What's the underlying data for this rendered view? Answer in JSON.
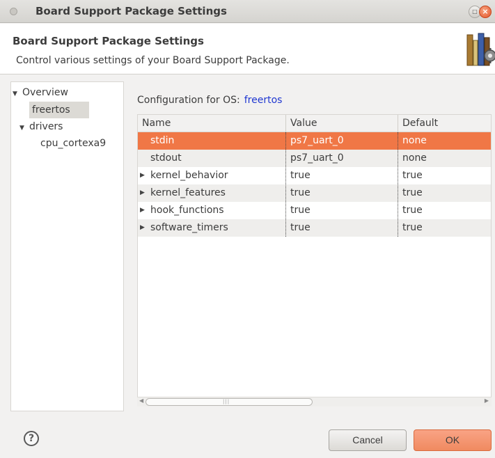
{
  "window": {
    "title": "Board Support Package Settings"
  },
  "header": {
    "title": "Board Support Package Settings",
    "description": "Control various settings of your Board Support Package."
  },
  "nav": {
    "items": [
      {
        "label": "Overview",
        "expanded": true
      },
      {
        "label": "freertos",
        "selected": true
      },
      {
        "label": "drivers",
        "expanded": true
      },
      {
        "label": "cpu_cortexa9"
      }
    ]
  },
  "config": {
    "label": "Configuration for OS:",
    "os": "freertos"
  },
  "table": {
    "columns": [
      "Name",
      "Value",
      "Default"
    ],
    "rows": [
      {
        "name": "stdin",
        "value": "ps7_uart_0",
        "default": "none",
        "expandable": false,
        "selected": true
      },
      {
        "name": "stdout",
        "value": "ps7_uart_0",
        "default": "none",
        "expandable": false
      },
      {
        "name": "kernel_behavior",
        "value": "true",
        "default": "true",
        "expandable": true
      },
      {
        "name": "kernel_features",
        "value": "true",
        "default": "true",
        "expandable": true
      },
      {
        "name": "hook_functions",
        "value": "true",
        "default": "true",
        "expandable": true
      },
      {
        "name": "software_timers",
        "value": "true",
        "default": "true",
        "expandable": true
      }
    ]
  },
  "buttons": {
    "cancel": "Cancel",
    "ok": "OK"
  },
  "icons": {
    "help": "help-icon",
    "header_graphic": "books-gear-icon",
    "expand": "triangle-right-icon",
    "collapse": "triangle-down-icon"
  },
  "colors": {
    "selected_row": "#f07746",
    "ok_button": "#f08a60",
    "link": "#1f37d1"
  }
}
